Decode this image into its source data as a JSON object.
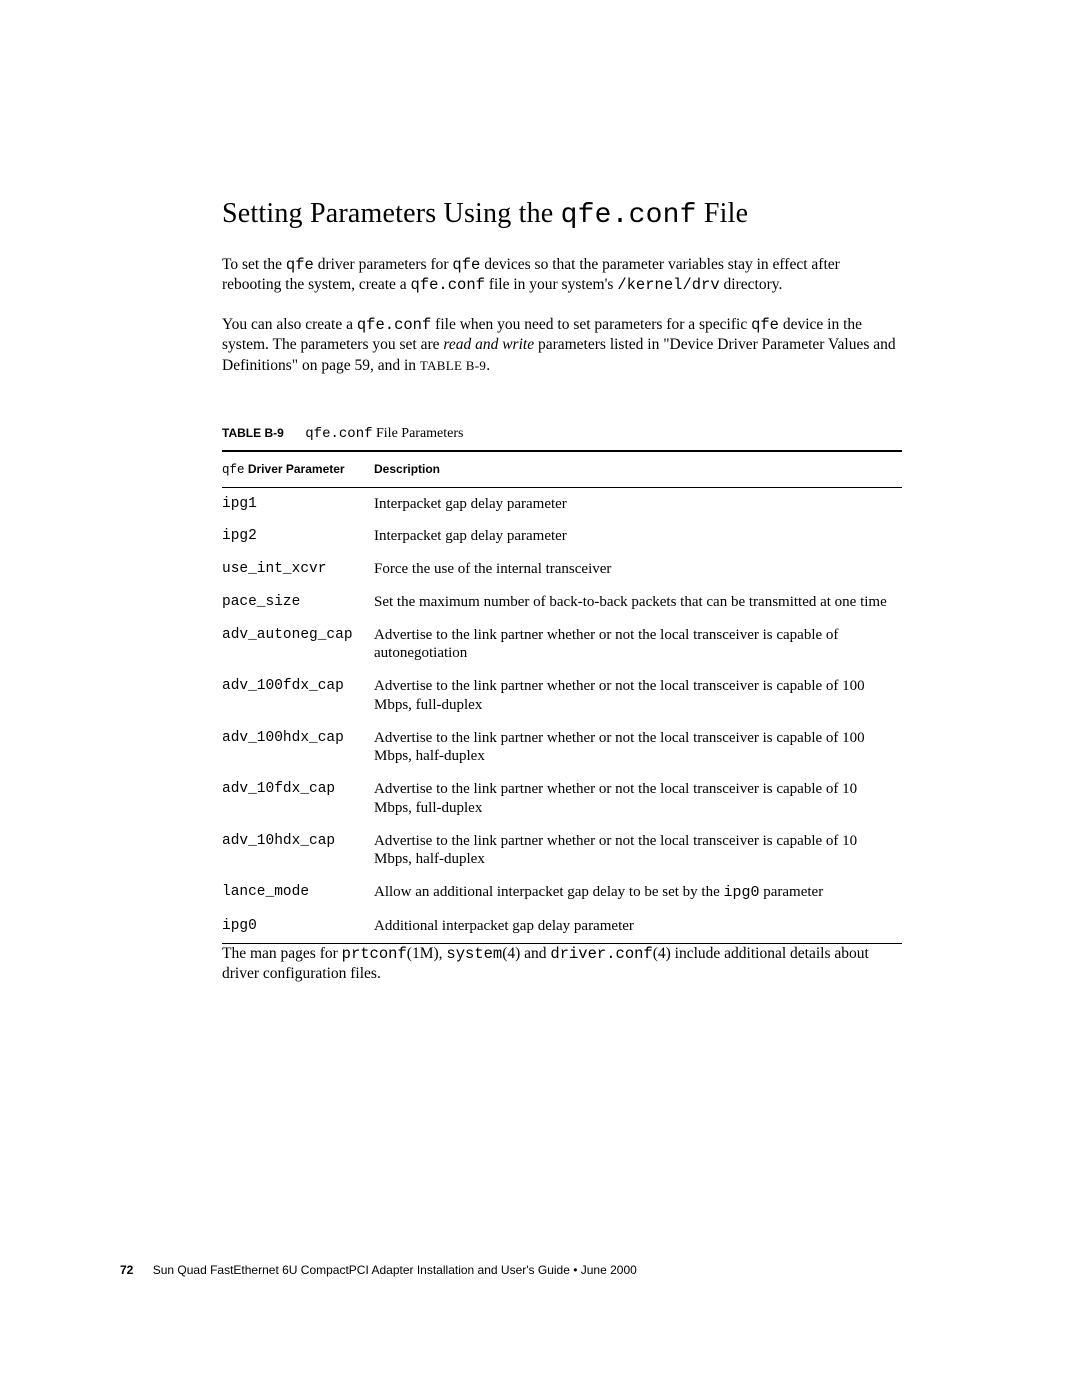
{
  "heading": {
    "prefix": "Setting Parameters Using the ",
    "code": "qfe.conf",
    "suffix": " File"
  },
  "para1": {
    "p1": "To set the ",
    "c1": "qfe",
    "p2": " driver parameters for ",
    "c2": "qfe",
    "p3": " devices so that the parameter variables stay in effect after rebooting the system, create a ",
    "c3": "qfe.conf",
    "p4": " file in your system's ",
    "c4": "/kernel/drv",
    "p5": " directory."
  },
  "para2": {
    "p1": "You can also create a ",
    "c1": "qfe.conf",
    "p2": " file when you need to set parameters for a specific ",
    "c2": "qfe",
    "p3": " device in the system. The parameters you set are ",
    "em1": "read and write",
    "p4": " parameters listed in \"Device Driver Parameter Values and Definitions\" on page 59, and in ",
    "sc1": "TABLE B-9",
    "p5": "."
  },
  "caption": {
    "label": "TABLE B-9",
    "code": "qfe.conf",
    "suffix": " File Parameters"
  },
  "table": {
    "head": {
      "param_code": "qfe",
      "param_rest": " Driver Parameter",
      "desc": "Description"
    },
    "rows": [
      {
        "name": "ipg1",
        "desc_pre": "Interpacket gap delay parameter",
        "code": "",
        "desc_post": ""
      },
      {
        "name": "ipg2",
        "desc_pre": "Interpacket gap delay parameter",
        "code": "",
        "desc_post": ""
      },
      {
        "name": "use_int_xcvr",
        "desc_pre": "Force the use of the internal transceiver",
        "code": "",
        "desc_post": ""
      },
      {
        "name": "pace_size",
        "desc_pre": "Set the maximum number of back-to-back packets that can be transmitted at one time",
        "code": "",
        "desc_post": ""
      },
      {
        "name": "adv_autoneg_cap",
        "desc_pre": "Advertise to the link partner whether or not the local transceiver is capable of autonegotiation",
        "code": "",
        "desc_post": ""
      },
      {
        "name": "adv_100fdx_cap",
        "desc_pre": "Advertise to the link partner whether or not the local transceiver is capable of 100 Mbps, full-duplex",
        "code": "",
        "desc_post": ""
      },
      {
        "name": "adv_100hdx_cap",
        "desc_pre": "Advertise to the link partner whether or not the local transceiver is capable of 100 Mbps, half-duplex",
        "code": "",
        "desc_post": ""
      },
      {
        "name": "adv_10fdx_cap",
        "desc_pre": "Advertise to the link partner whether or not the local transceiver is capable of 10 Mbps, full-duplex",
        "code": "",
        "desc_post": ""
      },
      {
        "name": "adv_10hdx_cap",
        "desc_pre": "Advertise to the link partner whether or not the local transceiver is capable of 10 Mbps, half-duplex",
        "code": "",
        "desc_post": ""
      },
      {
        "name": "lance_mode",
        "desc_pre": "Allow an additional interpacket gap delay to be set by the ",
        "code": "ipg0",
        "desc_post": " parameter"
      },
      {
        "name": "ipg0",
        "desc_pre": "Additional interpacket gap delay parameter",
        "code": "",
        "desc_post": ""
      }
    ]
  },
  "para3": {
    "p1": "The man pages for ",
    "c1": "prtconf",
    "p2": "(1M), ",
    "c2": "system",
    "p3": "(4) and ",
    "c3": "driver.conf",
    "p4": "(4) include additional details about driver configuration files."
  },
  "footer": {
    "page_number": "72",
    "text": "Sun Quad FastEthernet 6U CompactPCI Adapter Installation and User's Guide  •  June 2000"
  }
}
